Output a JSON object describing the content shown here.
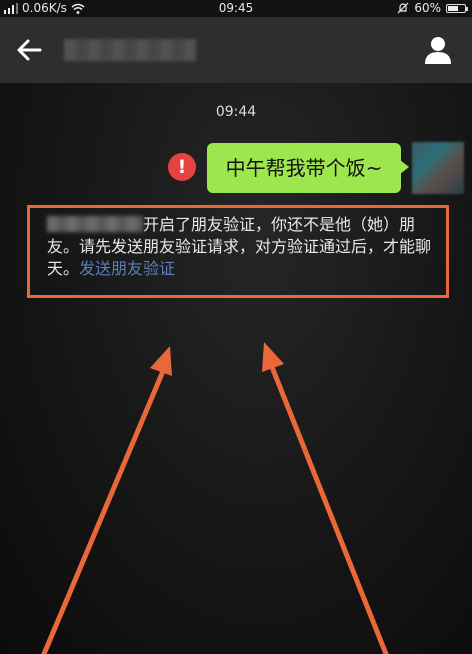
{
  "status_bar": {
    "speed": "0.06K/s",
    "time": "09:45",
    "battery": "60%",
    "battery_level": 0.6
  },
  "chat": {
    "timestamp": "09:44",
    "sent_message": "中午帮我带个饭~",
    "system_notice": "开启了朋友验证，你还不是他（她）朋友。请先发送朋友验证请求，对方验证通过后，才能聊天。",
    "notice_link": "发送朋友验证",
    "alert_icon": "!"
  },
  "colors": {
    "bubble": "#9ee64e",
    "alert": "#e64340",
    "highlight": "#e8683a",
    "link": "#5b7fb8"
  },
  "icons": [
    "signal-icon",
    "wifi-icon",
    "alarm-icon",
    "battery-icon",
    "back-arrow-icon",
    "profile-icon",
    "alert-icon"
  ]
}
